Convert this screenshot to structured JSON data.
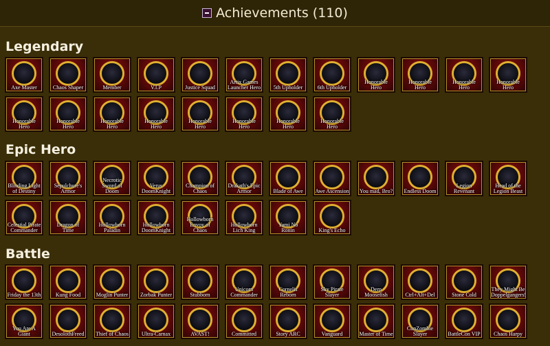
{
  "header": {
    "title": "Achievements (110)"
  },
  "sections": [
    {
      "title": "Legendary",
      "badges": [
        "Axe Master",
        "Chaos Shaper",
        "Member",
        "V.I.P",
        "Justice Squad",
        "Artix Games Launcher Hero",
        "5th Upholder",
        "6th Upholder",
        "Honorable Hero",
        "Honorable Hero",
        "Honorable Hero",
        "Honorable Hero",
        "Honorable Hero",
        "Honorable Hero",
        "Honorable Hero",
        "Honorable Hero",
        "Honorable Hero",
        "Honorable Hero",
        "Honorable Hero",
        "Honorable Hero"
      ]
    },
    {
      "title": "Epic Hero",
      "badges": [
        "Blinding Light of Destiny",
        "Sepulchure's Armor",
        "Necrotic Sword of Doom",
        "Verus DoomKnight",
        "Champion of Chaos",
        "Drakath's Epic Armor",
        "Blade of Awe",
        "Awe Ascension",
        "You mad, Bro?",
        "Endless Doom",
        "Legion Revenant",
        "Head of the Legion Beast",
        "Celestial Pirate Commander",
        "Dragon of Time",
        "Hollowborn Paladin",
        "Hollowborn DoomKnight",
        "Hollowborn Envoy of Chaos",
        "Hollowborn Lich King",
        "Yami No Ronin",
        "King's Echo"
      ]
    },
    {
      "title": "Battle",
      "badges": [
        "Friday the 13th",
        "Kung Food",
        "Moglin Punter",
        "Zorbak Punter",
        "Stubborn",
        "Unicorn Commander",
        "Cornelis Reborn",
        "Sky Pirate Slayer",
        "Derp Moosefish",
        "Ctrl+Alt+Del",
        "Stone Cold",
        "They Might Be Doppelgangers!",
        "You Are A Giant",
        "DesolothFreed",
        "Thief of Chaos",
        "Ultra-Carnax",
        "AVAST!",
        "Committed",
        "Story ARC",
        "Vanguard",
        "Master of Time",
        "ConZombie Slayer",
        "BattleCon VIP",
        "Chaos Harpy"
      ]
    }
  ]
}
